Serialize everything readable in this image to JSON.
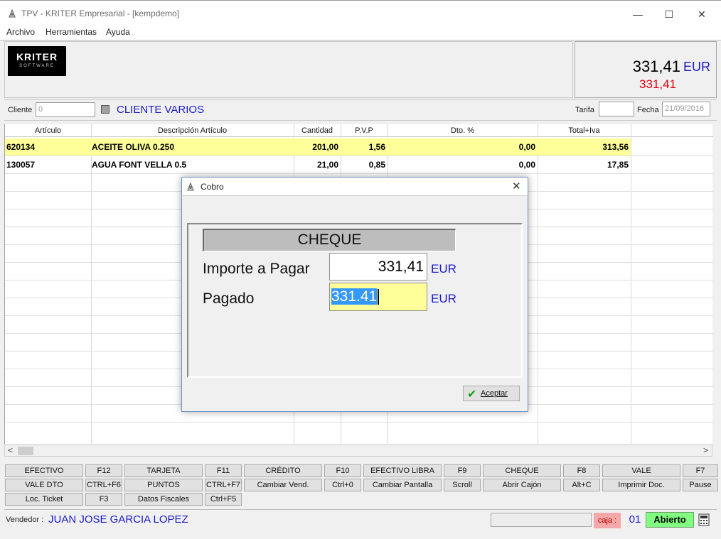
{
  "window": {
    "title": "TPV - KRITER Empresarial -  [kempdemo]",
    "minimize": "—",
    "maximize": "☐",
    "close": "✕"
  },
  "menu": {
    "items": [
      "Archivo",
      "Herramientas",
      "Ayuda"
    ]
  },
  "logo": {
    "line1": "KRITER",
    "line2": "SOFTWARE"
  },
  "total": {
    "amount": "331,41",
    "currency": "EUR",
    "red_amount": "331,41"
  },
  "client": {
    "label": "Cliente",
    "code": "0",
    "name": "CLIENTE VARIOS",
    "tarifa_label": "Tarifa",
    "tarifa_value": "",
    "fecha_label": "Fecha",
    "fecha_value": "21/09/2016"
  },
  "grid": {
    "columns": [
      "Artículo",
      "Descripción Artículo",
      "Cantidad",
      "P.V.P",
      "Dto. %",
      "Total+Iva"
    ],
    "rows": [
      {
        "articulo": "620134",
        "descripcion": "ACEITE OLIVA 0.250",
        "cantidad": "201,00",
        "pvp": "1,56",
        "dto": "0,00",
        "total": "313,56",
        "selected": true
      },
      {
        "articulo": "130057",
        "descripcion": "AGUA FONT VELLA 0.5",
        "cantidad": "21,00",
        "pvp": "0,85",
        "dto": "0,00",
        "total": "17,85",
        "selected": false
      }
    ]
  },
  "scroll": {
    "left": "<",
    "right": ">"
  },
  "function_keys": {
    "row1": [
      {
        "label": "EFECTIVO",
        "key": "F12"
      },
      {
        "label": "TARJETA",
        "key": "F11"
      },
      {
        "label": "CRÉDITO",
        "key": "F10"
      },
      {
        "label": "EFECTIVO LIBRA",
        "key": "F9"
      },
      {
        "label": "CHEQUE",
        "key": "F8"
      },
      {
        "label": "VALE",
        "key": "F7"
      }
    ],
    "row2": [
      {
        "label": "VALE DTO",
        "key": "CTRL+F6"
      },
      {
        "label": "PUNTOS",
        "key": "CTRL+F7"
      },
      {
        "label": "Cambiar Vend.",
        "key": "Ctrl+0"
      },
      {
        "label": "Cambiar Pantalla",
        "key": "Scroll"
      },
      {
        "label": "Abrir Cajón",
        "key": "Alt+C"
      },
      {
        "label": "Imprimir Doc.",
        "key": "Pause"
      }
    ],
    "row3": [
      {
        "label": "Loc. Ticket",
        "key": "F3"
      },
      {
        "label": "Datos Fiscales",
        "key": "Ctrl+F5"
      }
    ]
  },
  "status": {
    "vendor_label": "Vendedor :",
    "vendor_name": "JUAN JOSE GARCIA LOPEZ",
    "caja_label": "caja :",
    "caja_number": "01",
    "state": "Abierto"
  },
  "dialog": {
    "title": "Cobro",
    "close": "✕",
    "method": "CHEQUE",
    "importe_label": "Importe a Pagar",
    "importe_value": "331,41",
    "pagado_label": "Pagado",
    "pagado_value": "331.41",
    "currency": "EUR",
    "accept_label": "Aceptar"
  },
  "colors": {
    "accent_blue": "#1a1acc",
    "total_red": "#e0000e",
    "selected_row": "#ffff99",
    "abierto_green": "#80ff80",
    "caja_pink": "#f4a8a8"
  }
}
